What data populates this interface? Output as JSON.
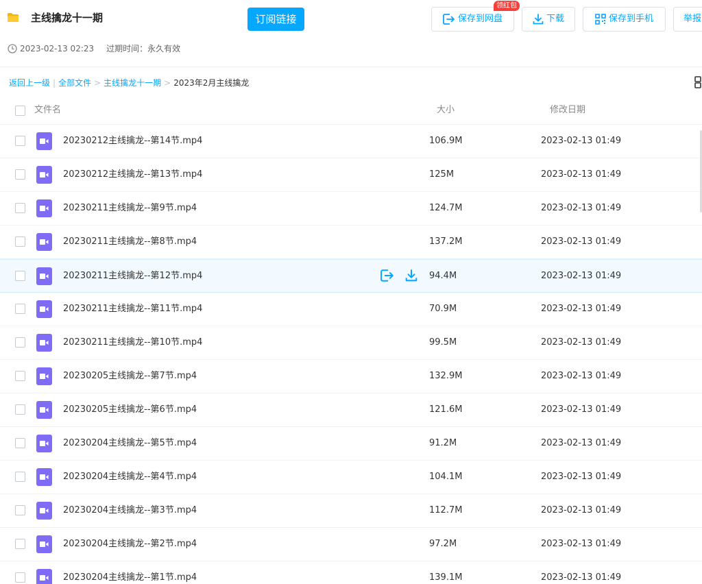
{
  "header": {
    "title": "主线擒龙十一期",
    "subscribe_label": "订阅链接",
    "save_label": "保存到网盘",
    "redpacket_badge": "领红包",
    "download_label": "下载",
    "save_phone_label": "保存到手机",
    "report_label": "举报",
    "share_time": "2023-02-13 02:23",
    "expire_text": "过期时间：永久有效"
  },
  "breadcrumb": {
    "back": "返回上一级",
    "sep": "|",
    "all_files": "全部文件",
    "arrow": ">",
    "parent": "主线擒龙十一期",
    "current": "2023年2月主线擒龙"
  },
  "table": {
    "col_name": "文件名",
    "col_size": "大小",
    "col_date": "修改日期",
    "rows": [
      {
        "name": "20230212主线擒龙--第14节.mp4",
        "size": "106.9M",
        "date": "2023-02-13 01:49"
      },
      {
        "name": "20230212主线擒龙--第13节.mp4",
        "size": "125M",
        "date": "2023-02-13 01:49"
      },
      {
        "name": "20230211主线擒龙--第9节.mp4",
        "size": "124.7M",
        "date": "2023-02-13 01:49"
      },
      {
        "name": "20230211主线擒龙--第8节.mp4",
        "size": "137.2M",
        "date": "2023-02-13 01:49"
      },
      {
        "name": "20230211主线擒龙--第12节.mp4",
        "size": "94.4M",
        "date": "2023-02-13 01:49"
      },
      {
        "name": "20230211主线擒龙--第11节.mp4",
        "size": "70.9M",
        "date": "2023-02-13 01:49"
      },
      {
        "name": "20230211主线擒龙--第10节.mp4",
        "size": "99.5M",
        "date": "2023-02-13 01:49"
      },
      {
        "name": "20230205主线擒龙--第7节.mp4",
        "size": "132.9M",
        "date": "2023-02-13 01:49"
      },
      {
        "name": "20230205主线擒龙--第6节.mp4",
        "size": "121.6M",
        "date": "2023-02-13 01:49"
      },
      {
        "name": "20230204主线擒龙--第5节.mp4",
        "size": "91.2M",
        "date": "2023-02-13 01:49"
      },
      {
        "name": "20230204主线擒龙--第4节.mp4",
        "size": "104.1M",
        "date": "2023-02-13 01:49"
      },
      {
        "name": "20230204主线擒龙--第3节.mp4",
        "size": "112.7M",
        "date": "2023-02-13 01:49"
      },
      {
        "name": "20230204主线擒龙--第2节.mp4",
        "size": "97.2M",
        "date": "2023-02-13 01:49"
      },
      {
        "name": "20230204主线擒龙--第1节.mp4",
        "size": "139.1M",
        "date": "2023-02-13 01:49"
      }
    ]
  },
  "colors": {
    "accent": "#06a7ff",
    "video_icon": "#7f6cf6",
    "redpacket": "#f5403c",
    "folder": "#f7b500"
  },
  "icons": [
    "folder-icon",
    "clock-icon",
    "save-to-cloud-icon",
    "download-icon",
    "qr-code-icon",
    "grid-view-icon",
    "video-file-icon"
  ]
}
